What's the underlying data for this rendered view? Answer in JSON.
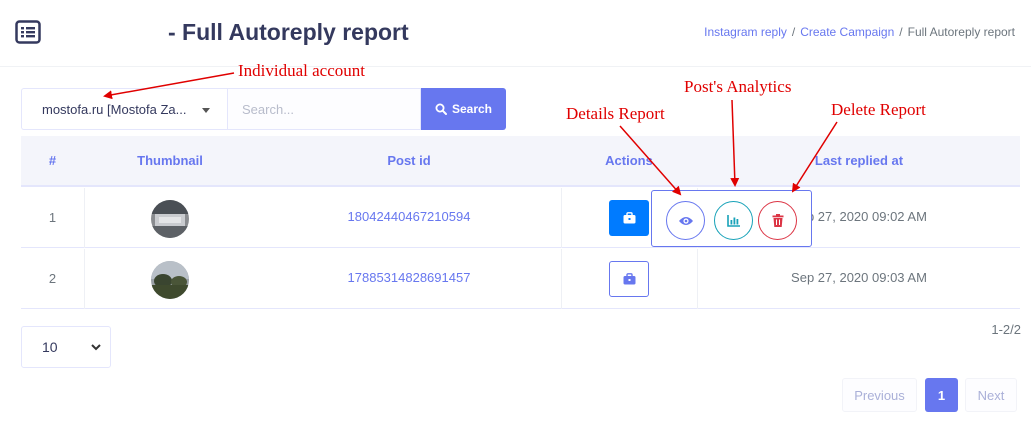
{
  "header": {
    "menu_icon": "list-icon",
    "title": "- Full Autoreply report",
    "breadcrumb": [
      "Instagram reply",
      "Create Campaign",
      "Full Autoreply report"
    ]
  },
  "filters": {
    "account_selected": "mostofa.ru [Mostofa Za...",
    "search_placeholder": "Search...",
    "search_button": "Search",
    "search_icon": "search-icon"
  },
  "table": {
    "columns": [
      "#",
      "Thumbnail",
      "Post id",
      "Actions",
      "Last replied at"
    ],
    "rows": [
      {
        "num": "1",
        "post_id": "18042440467210594",
        "last_replied": "Sep 27, 2020 09:02 AM"
      },
      {
        "num": "2",
        "post_id": "17885314828691457",
        "last_replied": "Sep 27, 2020 09:03 AM"
      }
    ]
  },
  "action_popover": {
    "details_icon": "eye-icon",
    "analytics_icon": "bar-chart-icon",
    "delete_icon": "trash-icon"
  },
  "pagination": {
    "per_page": "10",
    "range": "1-2/2",
    "previous": "Previous",
    "current": "1",
    "next": "Next"
  },
  "annotations": {
    "individual_account": "Individual account",
    "details_report": "Details Report",
    "posts_analytics": "Post's Analytics",
    "delete_report": "Delete Report"
  },
  "colors": {
    "primary": "#6777ef",
    "blue_button": "#007bff",
    "analytics": "#17a2b8",
    "delete": "#dc3545",
    "annotation": "#e00000"
  }
}
